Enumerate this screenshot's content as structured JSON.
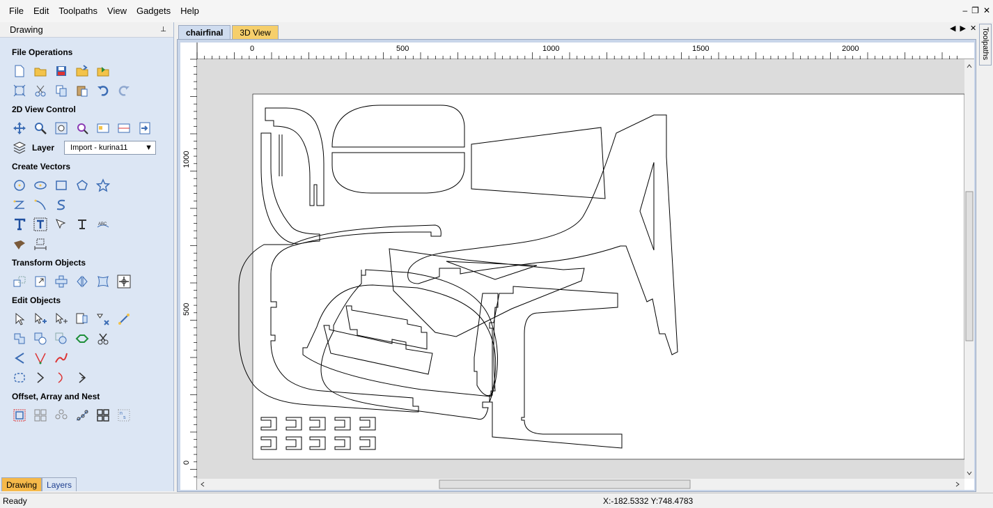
{
  "menu": [
    "File",
    "Edit",
    "Toolpaths",
    "View",
    "Gadgets",
    "Help"
  ],
  "window_controls": {
    "minimize": "–",
    "restore": "❐",
    "close": "✕"
  },
  "left_panel": {
    "title": "Drawing",
    "pin": "📌",
    "sections": {
      "file_operations": "File Operations",
      "view_control": "2D View Control",
      "create_vectors": "Create Vectors",
      "transform_objects": "Transform Objects",
      "edit_objects": "Edit Objects",
      "offset_array_nest": "Offset, Array and Nest"
    },
    "layer": {
      "label": "Layer",
      "value": "Import - kurina11"
    },
    "bottom_tabs": [
      "Drawing",
      "Layers"
    ]
  },
  "doc_tabs": [
    "chairfinal",
    "3D View"
  ],
  "tab_nav": {
    "prev": "◀",
    "next": "▶",
    "close": "✕"
  },
  "right_tab": "Toolpaths",
  "ruler": {
    "top_labels": [
      "0",
      "500",
      "1000",
      "1500",
      "2000"
    ],
    "left_labels": [
      "1000",
      "500",
      "0"
    ]
  },
  "status": {
    "text": "Ready",
    "coords": "X:-182.5332 Y:748.4783"
  },
  "colors": {
    "panel": "#dce6f4",
    "active_tab": "#f6b94a",
    "doc_tab_3d": "#f6cf6b"
  }
}
